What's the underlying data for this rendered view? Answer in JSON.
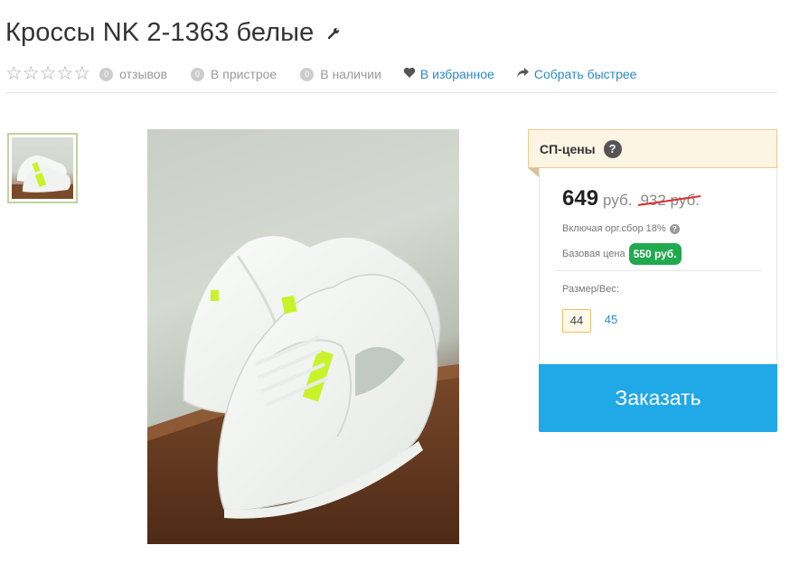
{
  "product": {
    "title": "Кроссы NK 2-1363 белые",
    "edit_icon": "wrench-icon"
  },
  "meta": {
    "rating_stars": 5,
    "rating_value": 0,
    "reviews_count": "0",
    "reviews_label": "отзывов",
    "in_progress_count": "0",
    "in_progress_label": "В пристрое",
    "in_stock_count": "0",
    "in_stock_label": "В наличии",
    "favorites_label": "В избранное",
    "favorites_icon": "heart-icon",
    "collect_label": "Собрать быстрее",
    "collect_icon": "share-arrow-icon"
  },
  "gallery": {
    "thumbnails": 1,
    "selected_index": 0
  },
  "pricing": {
    "header": "СП-цены",
    "help_glyph": "?",
    "price": "649",
    "currency": "руб.",
    "old_price": "932 руб.",
    "included_fee": "Включая орг.сбор 18%",
    "base_label": "Базовая цена",
    "base_price": "550 руб.",
    "size_label": "Размер/Вес:",
    "sizes": [
      "44",
      "45"
    ],
    "selected_size": "44",
    "order_button": "Заказать"
  },
  "colors": {
    "accent": "#21a8e6",
    "link": "#2b8ac6",
    "badge_green": "#22a94f",
    "strike_red": "#d9302c",
    "header_bg": "#fdf5e4",
    "header_border": "#f0c98a"
  }
}
